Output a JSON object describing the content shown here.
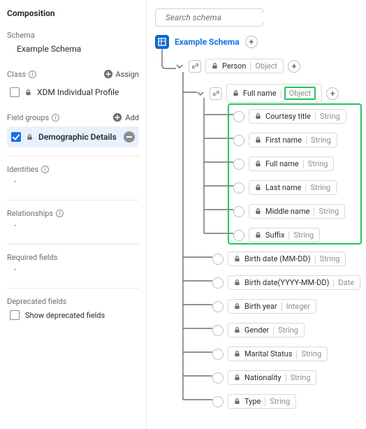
{
  "left": {
    "title": "Composition",
    "schema_lbl": "Schema",
    "schema_name": "Example Schema",
    "class_lbl": "Class",
    "assign_lbl": "Assign",
    "class_item": "XDM Individual Profile",
    "fg_lbl": "Field groups",
    "add_lbl": "Add",
    "fg_item": "Demographic Details",
    "identities_lbl": "Identities",
    "relationships_lbl": "Relationships",
    "required_lbl": "Required fields",
    "deprecated_lbl": "Deprecated fields",
    "deprecated_cb": "Show deprecated fields",
    "dash": "-"
  },
  "search": {
    "placeholder": "Search schema"
  },
  "tree": {
    "root": "Example Schema",
    "person": {
      "name": "Person",
      "type": "Object"
    },
    "fullname": {
      "name": "Full name",
      "type": "Object"
    },
    "name_fields": [
      {
        "name": "Courtesy title",
        "type": "String"
      },
      {
        "name": "First name",
        "type": "String"
      },
      {
        "name": "Full name",
        "type": "String"
      },
      {
        "name": "Last name",
        "type": "String"
      },
      {
        "name": "Middle name",
        "type": "String"
      },
      {
        "name": "Suffix",
        "type": "String"
      }
    ],
    "person_fields": [
      {
        "name": "Birth date (MM-DD)",
        "type": "String"
      },
      {
        "name": "Birth date(YYYY-MM-DD)",
        "type": "Date"
      },
      {
        "name": "Birth year",
        "type": "Integer"
      },
      {
        "name": "Gender",
        "type": "String"
      },
      {
        "name": "Marital Status",
        "type": "String"
      },
      {
        "name": "Nationality",
        "type": "String"
      },
      {
        "name": "Type",
        "type": "String"
      }
    ]
  }
}
